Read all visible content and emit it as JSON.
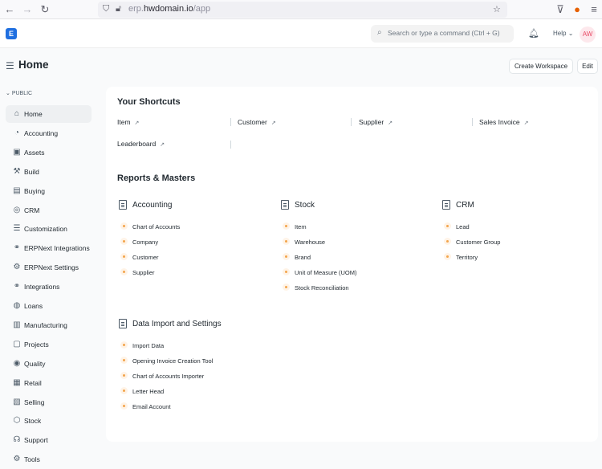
{
  "browser": {
    "url_prefix": "erp.",
    "url_domain": "hwdomain.io",
    "url_path": "/app",
    "back_icon": "back-arrow-icon",
    "forward_icon": "forward-arrow-icon",
    "reload_icon": "reload-icon"
  },
  "navbar": {
    "logo_letter": "E",
    "search_placeholder": "Search or type a command (Ctrl + G)",
    "help_label": "Help",
    "avatar_initials": "AW"
  },
  "page": {
    "title": "Home",
    "create_workspace_label": "Create Workspace",
    "edit_label": "Edit"
  },
  "sidebar": {
    "section_label": "PUBLIC",
    "items": [
      {
        "label": "Home",
        "icon": "home-icon",
        "glyph": "⌂"
      },
      {
        "label": "Accounting",
        "icon": "accounting-icon",
        "glyph": "◔"
      },
      {
        "label": "Assets",
        "icon": "assets-icon",
        "glyph": "▣"
      },
      {
        "label": "Build",
        "icon": "build-icon",
        "glyph": "⚒"
      },
      {
        "label": "Buying",
        "icon": "buying-icon",
        "glyph": "▤"
      },
      {
        "label": "CRM",
        "icon": "crm-icon",
        "glyph": "◎"
      },
      {
        "label": "Customization",
        "icon": "customization-icon",
        "glyph": "☰"
      },
      {
        "label": "ERPNext Integrations",
        "icon": "integrations-icon",
        "glyph": "⚭"
      },
      {
        "label": "ERPNext Settings",
        "icon": "settings-icon",
        "glyph": "⚙"
      },
      {
        "label": "Integrations",
        "icon": "integration-icon",
        "glyph": "⚭"
      },
      {
        "label": "Loans",
        "icon": "loans-icon",
        "glyph": "◍"
      },
      {
        "label": "Manufacturing",
        "icon": "manufacturing-icon",
        "glyph": "▥"
      },
      {
        "label": "Projects",
        "icon": "projects-icon",
        "glyph": "▢"
      },
      {
        "label": "Quality",
        "icon": "quality-icon",
        "glyph": "◉"
      },
      {
        "label": "Retail",
        "icon": "retail-icon",
        "glyph": "▦"
      },
      {
        "label": "Selling",
        "icon": "selling-icon",
        "glyph": "▧"
      },
      {
        "label": "Stock",
        "icon": "stock-icon",
        "glyph": "⬡"
      },
      {
        "label": "Support",
        "icon": "support-icon",
        "glyph": "☊"
      },
      {
        "label": "Tools",
        "icon": "tools-icon",
        "glyph": "⚙"
      }
    ]
  },
  "shortcuts": {
    "title": "Your Shortcuts",
    "items": [
      "Item",
      "Customer",
      "Supplier",
      "Sales Invoice",
      "Leaderboard"
    ]
  },
  "reports": {
    "title": "Reports & Masters",
    "groups": [
      {
        "title": "Accounting",
        "links": [
          "Chart of Accounts",
          "Company",
          "Customer",
          "Supplier"
        ]
      },
      {
        "title": "Stock",
        "links": [
          "Item",
          "Warehouse",
          "Brand",
          "Unit of Measure (UOM)",
          "Stock Reconciliation"
        ]
      },
      {
        "title": "CRM",
        "links": [
          "Lead",
          "Customer Group",
          "Territory"
        ]
      },
      {
        "title": "Data Import and Settings",
        "links": [
          "Import Data",
          "Opening Invoice Creation Tool",
          "Chart of Accounts Importer",
          "Letter Head",
          "Email Account"
        ]
      }
    ]
  },
  "colors": {
    "accent": "#1f6fe0",
    "link_dot": "#f3a54d",
    "avatar_text": "#e84964"
  }
}
